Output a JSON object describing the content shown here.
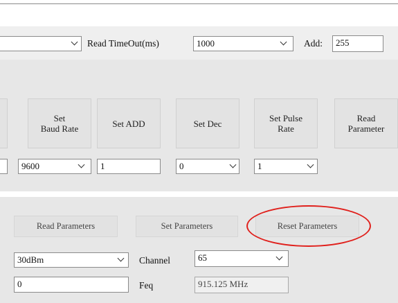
{
  "top_row": {
    "left_combo_value": "",
    "timeout_label": "Read TimeOut(ms)",
    "timeout_value": "1000",
    "add_label": "Add:",
    "add_value": "255"
  },
  "param_buttons": [
    {
      "line1": "Set",
      "line2": "Baud Rate"
    },
    {
      "line1": "Set ADD",
      "line2": ""
    },
    {
      "line1": "Set Dec",
      "line2": ""
    },
    {
      "line1": "Set Pulse",
      "line2": "Rate"
    },
    {
      "line1": "Read",
      "line2": "Parameter"
    }
  ],
  "param_inputs": {
    "baud_rate": "9600",
    "address": "1",
    "dec": "0",
    "pulse_rate": "1"
  },
  "bottom": {
    "read_parameters": "Read Parameters",
    "set_parameters": "Set Parameters",
    "reset_parameters": "Reset Parameters",
    "power_value": "30dBm",
    "channel_label": "Channel",
    "channel_value": "65",
    "freq_input_value": "0",
    "freq_label": "Feq",
    "freq_display": "915.125 MHz"
  },
  "colors": {
    "highlight": "#e0201c"
  }
}
